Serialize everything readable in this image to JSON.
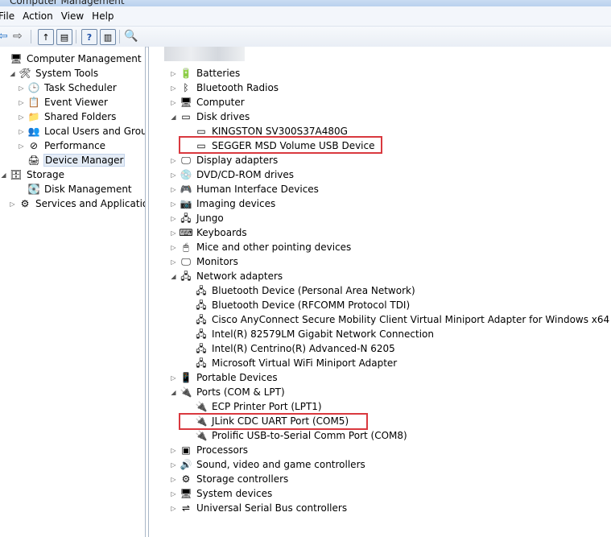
{
  "window": {
    "title": "Computer Management"
  },
  "menu": [
    "File",
    "Action",
    "View",
    "Help"
  ],
  "left_tree": [
    {
      "label": "Computer Management (Local",
      "icon": "computer-icon",
      "glyph": "🖥",
      "level": 0,
      "toggle": ""
    },
    {
      "label": "System Tools",
      "icon": "tools-icon",
      "glyph": "🛠",
      "level": 1,
      "toggle": "◢"
    },
    {
      "label": "Task Scheduler",
      "icon": "clock-icon",
      "glyph": "🕒",
      "level": 2,
      "toggle": "▷"
    },
    {
      "label": "Event Viewer",
      "icon": "event-viewer-icon",
      "glyph": "📋",
      "level": 2,
      "toggle": "▷"
    },
    {
      "label": "Shared Folders",
      "icon": "shared-folder-icon",
      "glyph": "📁",
      "level": 2,
      "toggle": "▷"
    },
    {
      "label": "Local Users and Groups",
      "icon": "users-icon",
      "glyph": "👥",
      "level": 2,
      "toggle": "▷"
    },
    {
      "label": "Performance",
      "icon": "performance-icon",
      "glyph": "⊘",
      "level": 2,
      "toggle": "▷"
    },
    {
      "label": "Device Manager",
      "icon": "device-manager-icon",
      "glyph": "🖨",
      "level": 2,
      "toggle": "",
      "selected": true
    },
    {
      "label": "Storage",
      "icon": "storage-icon",
      "glyph": "🗄",
      "level": 0,
      "toggle": "◢"
    },
    {
      "label": "Disk Management",
      "icon": "disk-icon",
      "glyph": "💽",
      "level": 2,
      "toggle": ""
    },
    {
      "label": "Services and Applications",
      "icon": "services-icon",
      "glyph": "⚙",
      "level": 1,
      "toggle": "▷"
    }
  ],
  "device_tree": [
    {
      "label": "Batteries",
      "icon": "battery-icon",
      "glyph": "🔋",
      "level": 0,
      "toggle": "▷"
    },
    {
      "label": "Bluetooth Radios",
      "icon": "bluetooth-icon",
      "glyph": "ᛒ",
      "level": 0,
      "toggle": "▷"
    },
    {
      "label": "Computer",
      "icon": "computer-icon",
      "glyph": "🖥",
      "level": 0,
      "toggle": "▷"
    },
    {
      "label": "Disk drives",
      "icon": "disk-drive-icon",
      "glyph": "▭",
      "level": 0,
      "toggle": "◢"
    },
    {
      "label": "KINGSTON SV300S37A480G",
      "icon": "disk-drive-icon",
      "glyph": "▭",
      "level": 1,
      "toggle": ""
    },
    {
      "label": "SEGGER MSD Volume USB Device",
      "icon": "disk-drive-icon",
      "glyph": "▭",
      "level": 1,
      "toggle": ""
    },
    {
      "label": "Display adapters",
      "icon": "display-icon",
      "glyph": "🖵",
      "level": 0,
      "toggle": "▷"
    },
    {
      "label": "DVD/CD-ROM drives",
      "icon": "dvd-icon",
      "glyph": "💿",
      "level": 0,
      "toggle": "▷"
    },
    {
      "label": "Human Interface Devices",
      "icon": "hid-icon",
      "glyph": "🎮",
      "level": 0,
      "toggle": "▷"
    },
    {
      "label": "Imaging devices",
      "icon": "camera-icon",
      "glyph": "📷",
      "level": 0,
      "toggle": "▷"
    },
    {
      "label": "Jungo",
      "icon": "network-icon",
      "glyph": "🖧",
      "level": 0,
      "toggle": "▷"
    },
    {
      "label": "Keyboards",
      "icon": "keyboard-icon",
      "glyph": "⌨",
      "level": 0,
      "toggle": "▷"
    },
    {
      "label": "Mice and other pointing devices",
      "icon": "mouse-icon",
      "glyph": "🖱",
      "level": 0,
      "toggle": "▷"
    },
    {
      "label": "Monitors",
      "icon": "monitor-icon",
      "glyph": "🖵",
      "level": 0,
      "toggle": "▷"
    },
    {
      "label": "Network adapters",
      "icon": "network-icon",
      "glyph": "🖧",
      "level": 0,
      "toggle": "◢"
    },
    {
      "label": "Bluetooth Device (Personal Area Network)",
      "icon": "network-icon",
      "glyph": "🖧",
      "level": 1,
      "toggle": ""
    },
    {
      "label": "Bluetooth Device (RFCOMM Protocol TDI)",
      "icon": "network-icon",
      "glyph": "🖧",
      "level": 1,
      "toggle": ""
    },
    {
      "label": "Cisco AnyConnect Secure Mobility Client Virtual Miniport Adapter for Windows x64",
      "icon": "network-icon",
      "glyph": "🖧",
      "level": 1,
      "toggle": ""
    },
    {
      "label": "Intel(R) 82579LM Gigabit Network Connection",
      "icon": "network-icon",
      "glyph": "🖧",
      "level": 1,
      "toggle": ""
    },
    {
      "label": "Intel(R) Centrino(R) Advanced-N 6205",
      "icon": "network-icon",
      "glyph": "🖧",
      "level": 1,
      "toggle": ""
    },
    {
      "label": "Microsoft Virtual WiFi Miniport Adapter",
      "icon": "network-icon",
      "glyph": "🖧",
      "level": 1,
      "toggle": ""
    },
    {
      "label": "Portable Devices",
      "icon": "portable-device-icon",
      "glyph": "📱",
      "level": 0,
      "toggle": "▷"
    },
    {
      "label": "Ports (COM & LPT)",
      "icon": "port-icon",
      "glyph": "🔌",
      "level": 0,
      "toggle": "◢"
    },
    {
      "label": "ECP Printer Port (LPT1)",
      "icon": "port-icon",
      "glyph": "🔌",
      "level": 1,
      "toggle": ""
    },
    {
      "label": "JLink CDC UART Port (COM5)",
      "icon": "port-icon",
      "glyph": "🔌",
      "level": 1,
      "toggle": ""
    },
    {
      "label": "Prolific USB-to-Serial Comm Port (COM8)",
      "icon": "port-icon",
      "glyph": "🔌",
      "level": 1,
      "toggle": ""
    },
    {
      "label": "Processors",
      "icon": "processor-icon",
      "glyph": "▣",
      "level": 0,
      "toggle": "▷"
    },
    {
      "label": "Sound, video and game controllers",
      "icon": "sound-icon",
      "glyph": "🔊",
      "level": 0,
      "toggle": "▷"
    },
    {
      "label": "Storage controllers",
      "icon": "storage-controller-icon",
      "glyph": "⚙",
      "level": 0,
      "toggle": "▷"
    },
    {
      "label": "System devices",
      "icon": "system-device-icon",
      "glyph": "🖥",
      "level": 0,
      "toggle": "▷"
    },
    {
      "label": "Universal Serial Bus controllers",
      "icon": "usb-icon",
      "glyph": "⇌",
      "level": 0,
      "toggle": "▷"
    }
  ],
  "highlight_color": "#d9393f"
}
